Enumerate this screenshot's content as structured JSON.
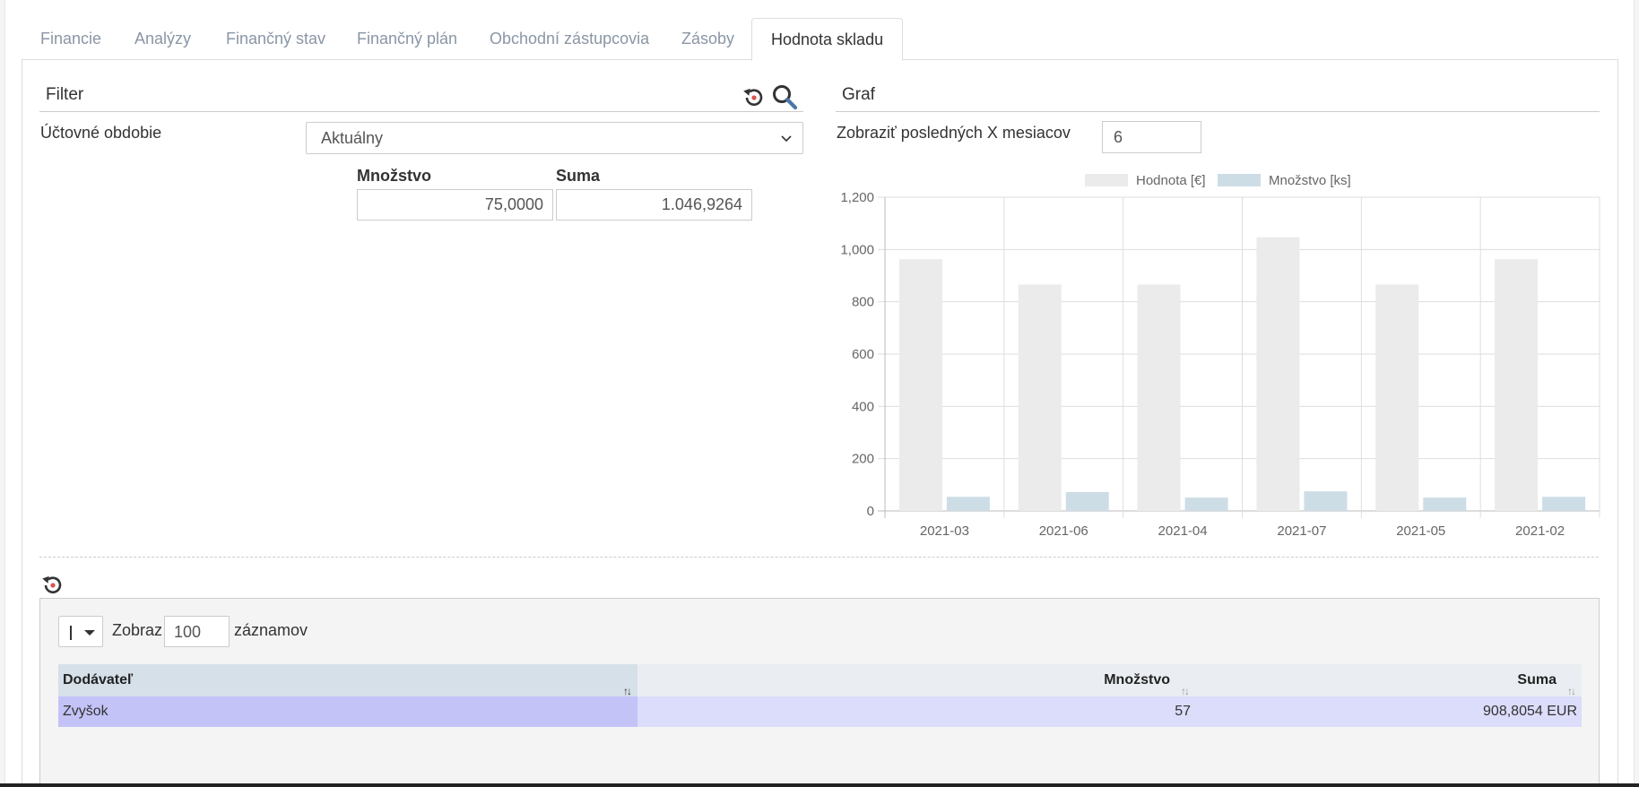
{
  "tabs": [
    {
      "label": "Financie",
      "active": false
    },
    {
      "label": "Analýzy",
      "active": false
    },
    {
      "label": "Finančný stav",
      "active": false
    },
    {
      "label": "Finančný plán",
      "active": false
    },
    {
      "label": "Obchodní zástupcovia",
      "active": false
    },
    {
      "label": "Zásoby",
      "active": false
    },
    {
      "label": "Hodnota skladu",
      "active": true
    }
  ],
  "filter": {
    "title": "Filter",
    "period_label": "Účtovné obdobie",
    "period_value": "Aktuálny",
    "qty_header": "Množstvo",
    "sum_header": "Suma",
    "qty_value": "75,0000",
    "sum_value": "1.046,9264",
    "reset_icon": "reset-icon",
    "search_icon": "search-icon"
  },
  "graph": {
    "title": "Graf",
    "months_label": "Zobraziť posledných X mesiacov",
    "months_value": "6"
  },
  "chart_data": {
    "type": "bar",
    "categories": [
      "2021-03",
      "2021-06",
      "2021-04",
      "2021-07",
      "2021-05",
      "2021-02"
    ],
    "series": [
      {
        "name": "Hodnota [€]",
        "values": [
          963,
          866,
          866,
          1047,
          866,
          963
        ],
        "color": "#ebebeb"
      },
      {
        "name": "Množstvo [ks]",
        "values": [
          54,
          72,
          51,
          75,
          51,
          54
        ],
        "color": "#cddde6"
      }
    ],
    "ylim": [
      0,
      1200
    ],
    "yticks": [
      "0",
      "200",
      "400",
      "600",
      "800",
      "1,000",
      "1,200"
    ],
    "grid": true,
    "legend": "top"
  },
  "table": {
    "reset_icon": "reset-icon",
    "show_label": "Zobraz",
    "page_size": "100",
    "records_label": "záznamov",
    "columns": [
      "Dodávateľ",
      "Množstvo",
      "Suma"
    ],
    "rows": [
      {
        "supplier": "Zvyšok",
        "qty": "57",
        "sum": "908,8054 EUR"
      }
    ]
  }
}
